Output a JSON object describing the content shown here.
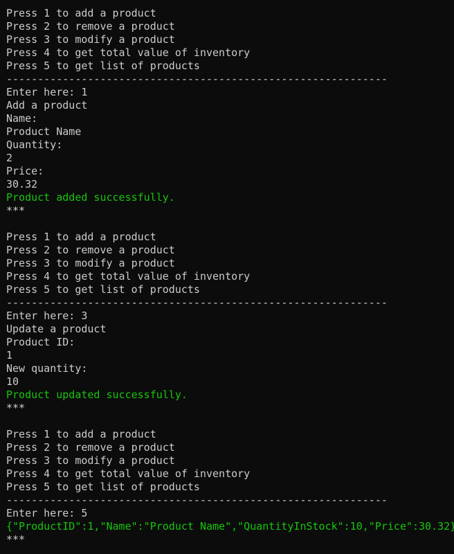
{
  "terminal": {
    "colors": {
      "background": "#0c0c0c",
      "text": "#cccccc",
      "success": "#16c60c"
    },
    "lines": [
      {
        "text": "Press 1 to add a product",
        "style": "default"
      },
      {
        "text": "Press 2 to remove a product",
        "style": "default"
      },
      {
        "text": "Press 3 to modify a product",
        "style": "default"
      },
      {
        "text": "Press 4 to get total value of inventory",
        "style": "default"
      },
      {
        "text": "Press 5 to get list of products",
        "style": "default"
      },
      {
        "text": "-------------------------------------------------------------",
        "style": "default"
      },
      {
        "text": "Enter here: 1",
        "style": "default"
      },
      {
        "text": "Add a product",
        "style": "default"
      },
      {
        "text": "Name:",
        "style": "default"
      },
      {
        "text": "Product Name",
        "style": "default"
      },
      {
        "text": "Quantity:",
        "style": "default"
      },
      {
        "text": "2",
        "style": "default"
      },
      {
        "text": "Price:",
        "style": "default"
      },
      {
        "text": "30.32",
        "style": "default"
      },
      {
        "text": "Product added successfully.",
        "style": "green"
      },
      {
        "text": "***",
        "style": "default"
      },
      {
        "text": "",
        "style": "default"
      },
      {
        "text": "Press 1 to add a product",
        "style": "default"
      },
      {
        "text": "Press 2 to remove a product",
        "style": "default"
      },
      {
        "text": "Press 3 to modify a product",
        "style": "default"
      },
      {
        "text": "Press 4 to get total value of inventory",
        "style": "default"
      },
      {
        "text": "Press 5 to get list of products",
        "style": "default"
      },
      {
        "text": "-------------------------------------------------------------",
        "style": "default"
      },
      {
        "text": "Enter here: 3",
        "style": "default"
      },
      {
        "text": "Update a product",
        "style": "default"
      },
      {
        "text": "Product ID:",
        "style": "default"
      },
      {
        "text": "1",
        "style": "default"
      },
      {
        "text": "New quantity:",
        "style": "default"
      },
      {
        "text": "10",
        "style": "default"
      },
      {
        "text": "Product updated successfully.",
        "style": "green"
      },
      {
        "text": "***",
        "style": "default"
      },
      {
        "text": "",
        "style": "default"
      },
      {
        "text": "Press 1 to add a product",
        "style": "default"
      },
      {
        "text": "Press 2 to remove a product",
        "style": "default"
      },
      {
        "text": "Press 3 to modify a product",
        "style": "default"
      },
      {
        "text": "Press 4 to get total value of inventory",
        "style": "default"
      },
      {
        "text": "Press 5 to get list of products",
        "style": "default"
      },
      {
        "text": "-------------------------------------------------------------",
        "style": "default"
      },
      {
        "text": "Enter here: 5",
        "style": "default"
      },
      {
        "text": "{\"ProductID\":1,\"Name\":\"Product Name\",\"QuantityInStock\":10,\"Price\":30.32}",
        "style": "green"
      },
      {
        "text": "***",
        "style": "default"
      }
    ]
  }
}
